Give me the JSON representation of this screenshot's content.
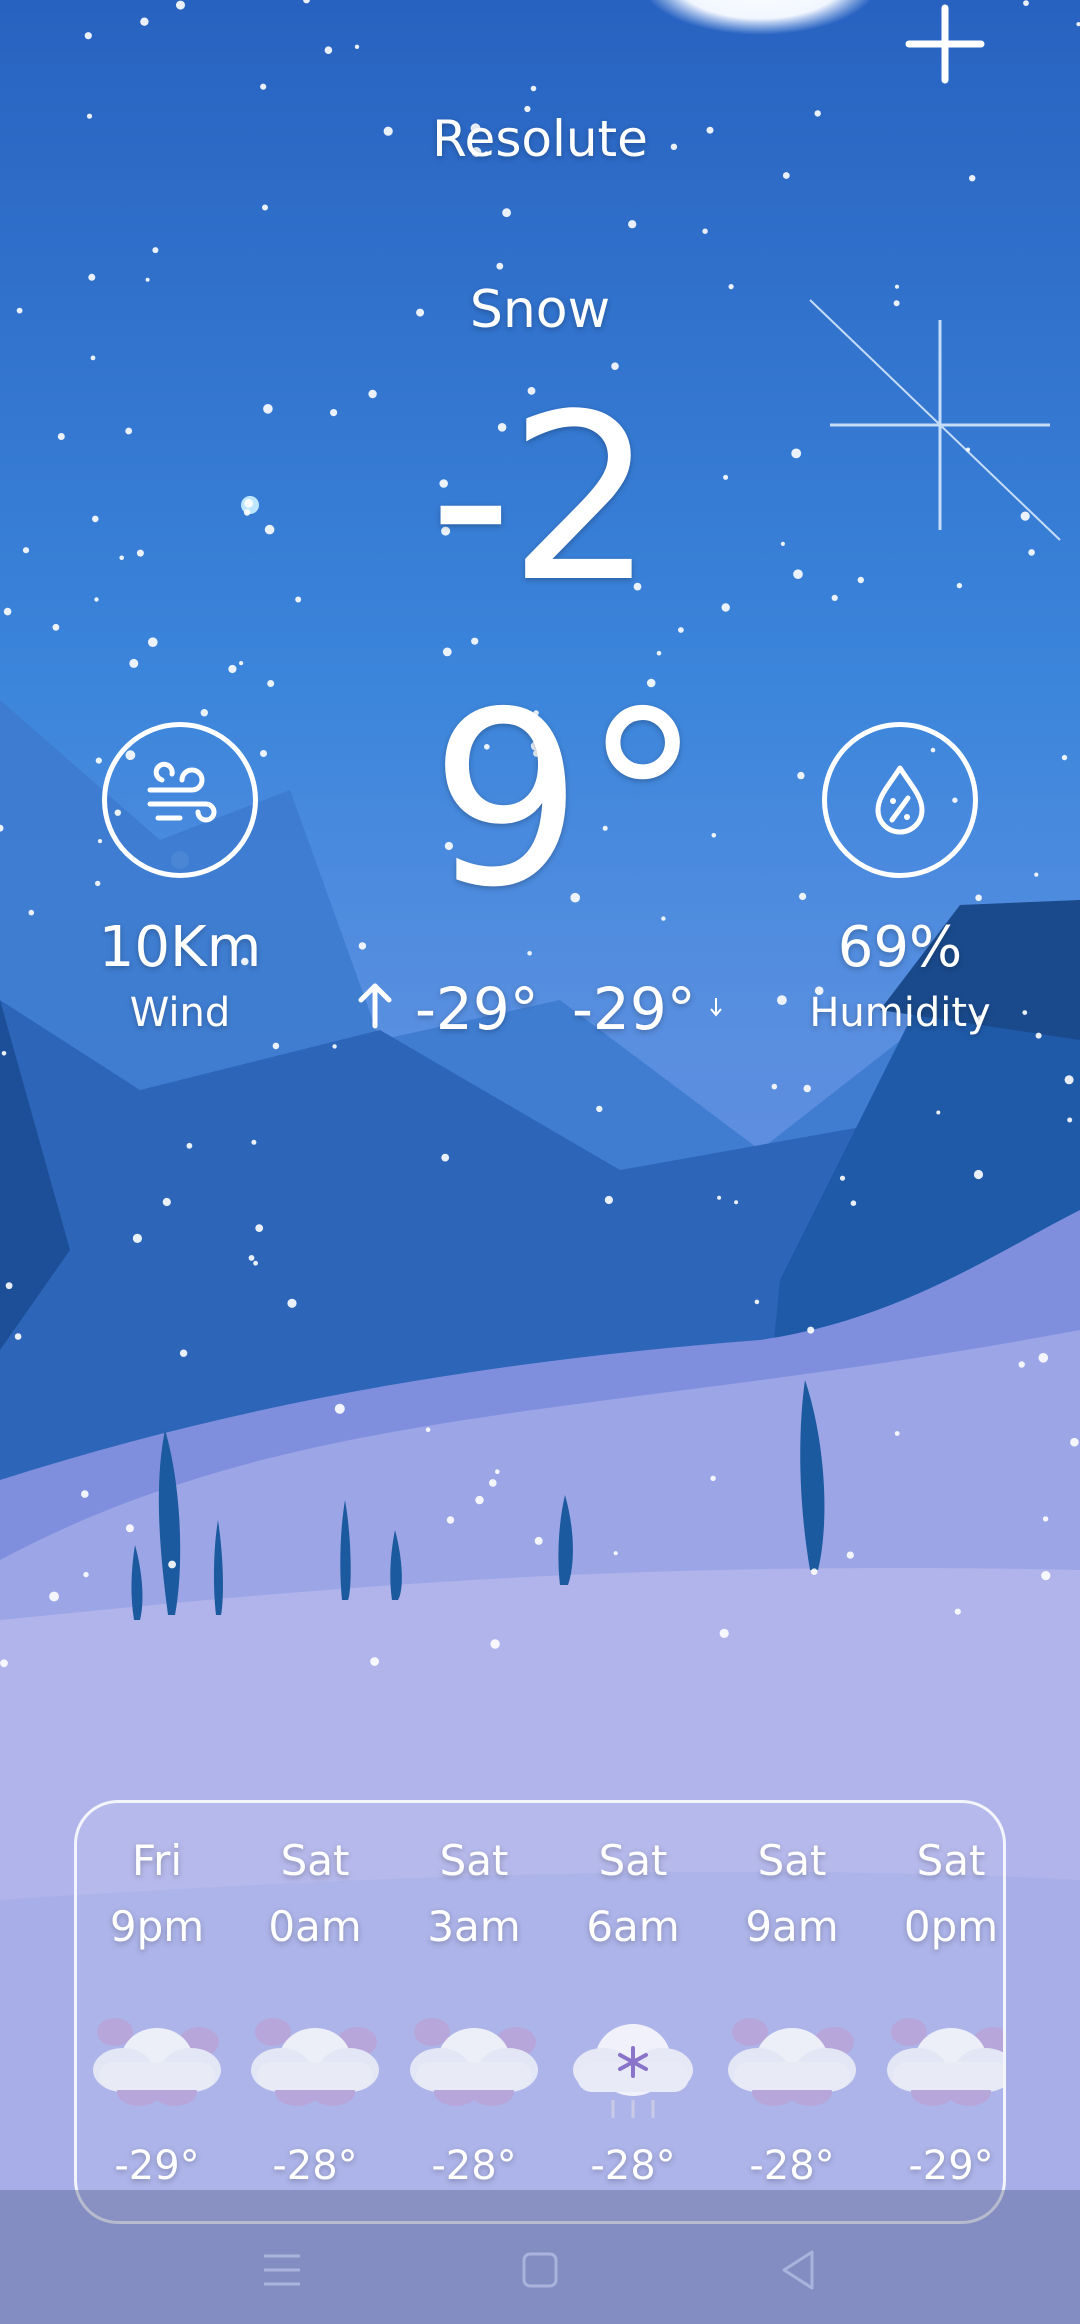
{
  "header": {
    "city": "Resolute",
    "add_icon": "plus-icon"
  },
  "current": {
    "condition": "Snow",
    "temp_small": "-2",
    "temp_big": "9°",
    "high": "-29°",
    "low": "-29°",
    "high_icon": "arrow-up-icon",
    "low_icon": "arrow-down-icon"
  },
  "wind": {
    "value": "10Km",
    "label": "Wind",
    "icon": "wind-icon"
  },
  "humidity": {
    "value": "69%",
    "label": "Humidity",
    "icon": "humidity-drop-icon"
  },
  "forecast": [
    {
      "day": "Fri",
      "time": "9pm",
      "temp": "-29°",
      "icon": "cloudy-icon"
    },
    {
      "day": "Sat",
      "time": "0am",
      "temp": "-28°",
      "icon": "cloudy-icon"
    },
    {
      "day": "Sat",
      "time": "3am",
      "temp": "-28°",
      "icon": "cloudy-icon"
    },
    {
      "day": "Sat",
      "time": "6am",
      "temp": "-28°",
      "icon": "snow-cloud-icon"
    },
    {
      "day": "Sat",
      "time": "9am",
      "temp": "-28°",
      "icon": "cloudy-icon"
    },
    {
      "day": "Sat",
      "time": "0pm",
      "temp": "-29°",
      "icon": "cloudy-icon"
    }
  ],
  "navbar": {
    "menu_icon": "menu-icon",
    "home_icon": "home-square-icon",
    "back_icon": "back-triangle-icon"
  },
  "colors": {
    "sky_top": "#2a68c4",
    "sky_mid": "#3d86dc",
    "snow_ground": "#b6b8ea",
    "mountain": "#1f5aa8"
  }
}
